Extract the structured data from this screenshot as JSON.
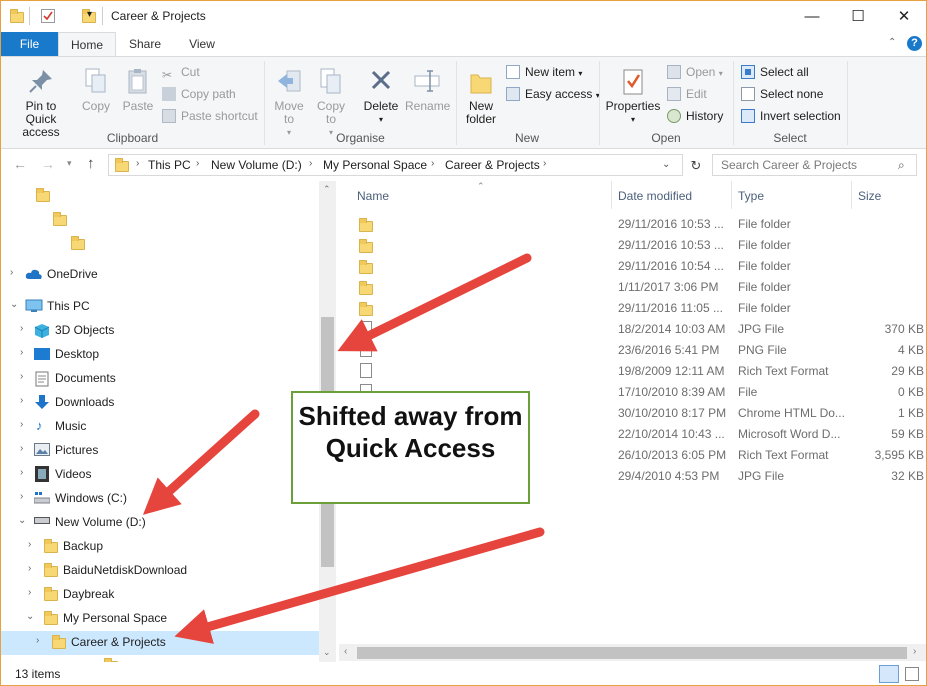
{
  "window": {
    "title": "Career & Projects",
    "controls": {
      "minimize": "—",
      "maximize": "☐",
      "close": "✕"
    }
  },
  "tabs": [
    "File",
    "Home",
    "Share",
    "View"
  ],
  "ribbon": {
    "clipboard": {
      "label": "Clipboard",
      "pin": "Pin to Quick access",
      "copy": "Copy",
      "paste": "Paste",
      "cut": "Cut",
      "copy_path": "Copy path",
      "paste_shortcut": "Paste shortcut"
    },
    "organise": {
      "label": "Organise",
      "move_to": "Move to",
      "copy_to": "Copy to",
      "delete": "Delete",
      "rename": "Rename"
    },
    "new": {
      "label": "New",
      "new_folder": "New folder",
      "new_item": "New item",
      "easy_access": "Easy access"
    },
    "open": {
      "label": "Open",
      "properties": "Properties",
      "open": "Open",
      "edit": "Edit",
      "history": "History"
    },
    "select": {
      "label": "Select",
      "select_all": "Select all",
      "select_none": "Select none",
      "invert_selection": "Invert selection"
    }
  },
  "address": {
    "crumbs": [
      "This PC",
      "New Volume (D:)",
      "My Personal Space",
      "Career & Projects"
    ],
    "search_placeholder": "Search Career & Projects"
  },
  "tree": {
    "onedrive": "OneDrive",
    "this_pc": "This PC",
    "items": [
      "3D Objects",
      "Desktop",
      "Documents",
      "Downloads",
      "Music",
      "Pictures",
      "Videos",
      "Windows (C:)",
      "New Volume (D:)"
    ],
    "d_children": [
      "Backup",
      "BaiduNetdiskDownload",
      "Daybreak",
      "My Personal Space"
    ],
    "selected": "Career & Projects"
  },
  "columns": {
    "name": "Name",
    "date": "Date modified",
    "type": "Type",
    "size": "Size"
  },
  "files": [
    {
      "date": "29/11/2016 10:53 ...",
      "type": "File folder",
      "size": ""
    },
    {
      "date": "29/11/2016 10:53 ...",
      "type": "File folder",
      "size": ""
    },
    {
      "date": "29/11/2016 10:54 ...",
      "type": "File folder",
      "size": ""
    },
    {
      "date": "1/11/2017 3:06 PM",
      "type": "File folder",
      "size": ""
    },
    {
      "date": "29/11/2016 11:05 ...",
      "type": "File folder",
      "size": ""
    },
    {
      "date": "18/2/2014 10:03 AM",
      "type": "JPG File",
      "size": "370 KB"
    },
    {
      "date": "23/6/2016 5:41 PM",
      "type": "PNG File",
      "size": "4 KB"
    },
    {
      "date": "19/8/2009 12:11 AM",
      "type": "Rich Text Format",
      "size": "29 KB"
    },
    {
      "date": "17/10/2010 8:39 AM",
      "type": "File",
      "size": "0 KB"
    },
    {
      "date": "30/10/2010 8:17 PM",
      "type": "Chrome HTML Do...",
      "size": "1 KB"
    },
    {
      "date": "22/10/2014 10:43 ...",
      "type": "Microsoft Word D...",
      "size": "59 KB"
    },
    {
      "date": "26/10/2013 6:05 PM",
      "type": "Rich Text Format",
      "size": "3,595 KB"
    },
    {
      "date": "29/4/2010 4:53 PM",
      "type": "JPG File",
      "size": "32 KB"
    }
  ],
  "status": {
    "count": "13 items"
  },
  "annotation": {
    "text": "Shifted away from Quick Access",
    "border_color": "#6a9f3a",
    "arrow_color": "#e5453d"
  },
  "colors": {
    "accent": "#1979ca",
    "selection": "#cce8ff",
    "folder": "#f8d775"
  }
}
